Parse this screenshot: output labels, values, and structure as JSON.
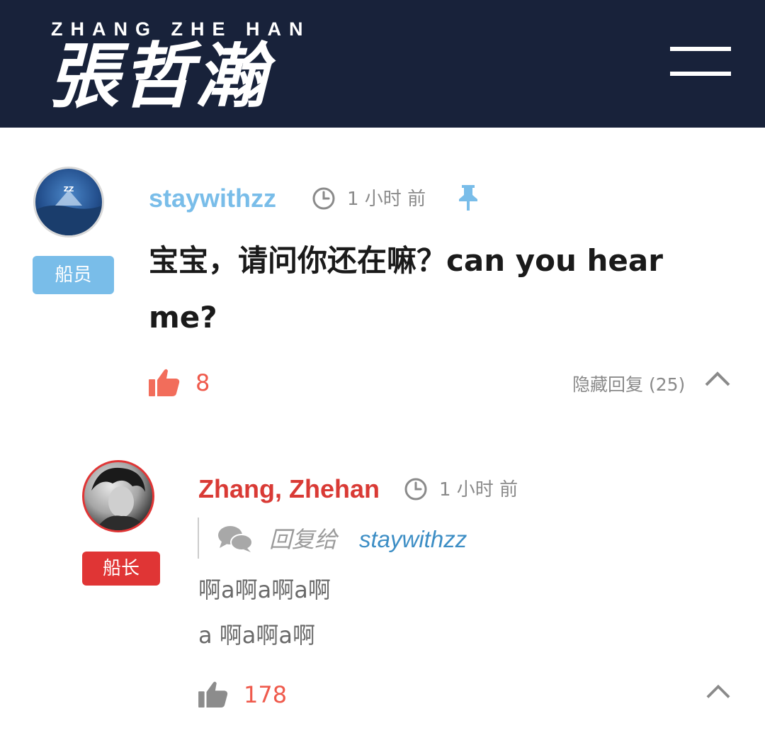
{
  "header": {
    "brand_en": "ZHANG ZHE HAN",
    "brand_cn": "張哲瀚",
    "menu_icon": "hamburger-menu-icon",
    "background": "#18223a"
  },
  "comment": {
    "username": "staywithzz",
    "role_badge": "船员",
    "time": "1 小时 前",
    "pinned_icon": "pin-icon",
    "text": "宝宝，请问你还在嘛？can you hear me?",
    "likes": "8",
    "hide_replies": "隐藏回复 (25)",
    "colors": {
      "username": "#79bde9",
      "badge": "#79bde9",
      "likes": "#ef5a4c"
    }
  },
  "reply": {
    "username": "Zhang, Zhehan",
    "role_badge": "船长",
    "time": "1 小时 前",
    "reply_to_label": "回复给",
    "reply_to_name": "staywithzz",
    "text_line_1": "啊a啊a啊a啊",
    "text_line_2": "a 啊a啊a啊",
    "likes": "178",
    "colors": {
      "username": "#d93a35",
      "badge": "#e03535",
      "reply_to": "#3d8ec5"
    }
  }
}
